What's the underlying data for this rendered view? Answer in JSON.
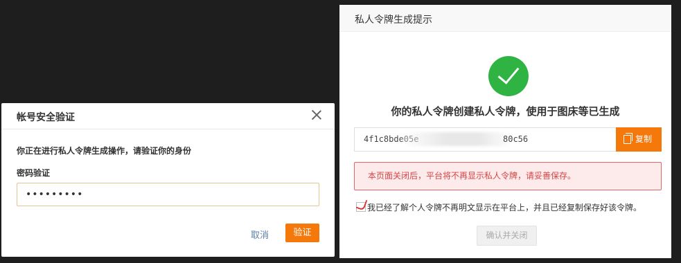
{
  "verify_dialog": {
    "title": "帐号安全验证",
    "prompt": "你正在进行私人令牌生成操作，请验证你的身份",
    "password_label": "密码验证",
    "password_value": "•••••••••",
    "cancel_label": "取消",
    "confirm_label": "验证"
  },
  "token_dialog": {
    "title": "私人令牌生成提示",
    "message": "你的私人令牌创建私人令牌，使用于图床等已生成",
    "token_prefix": "4f1c8bde05e",
    "token_suffix": "80c56",
    "copy_label": "复制",
    "warning": "本页面关闭后，平台将不再显示私人令牌，请妥善保存。",
    "acknowledge": "我已经了解个人令牌不再明文显示在平台上，并且已经复制保存好该令牌。",
    "close_label": "确认并关闭"
  },
  "colors": {
    "accent": "#f5780a",
    "success": "#2fb444",
    "warning_text": "#d64545",
    "backdrop": "#1e1e1e"
  }
}
